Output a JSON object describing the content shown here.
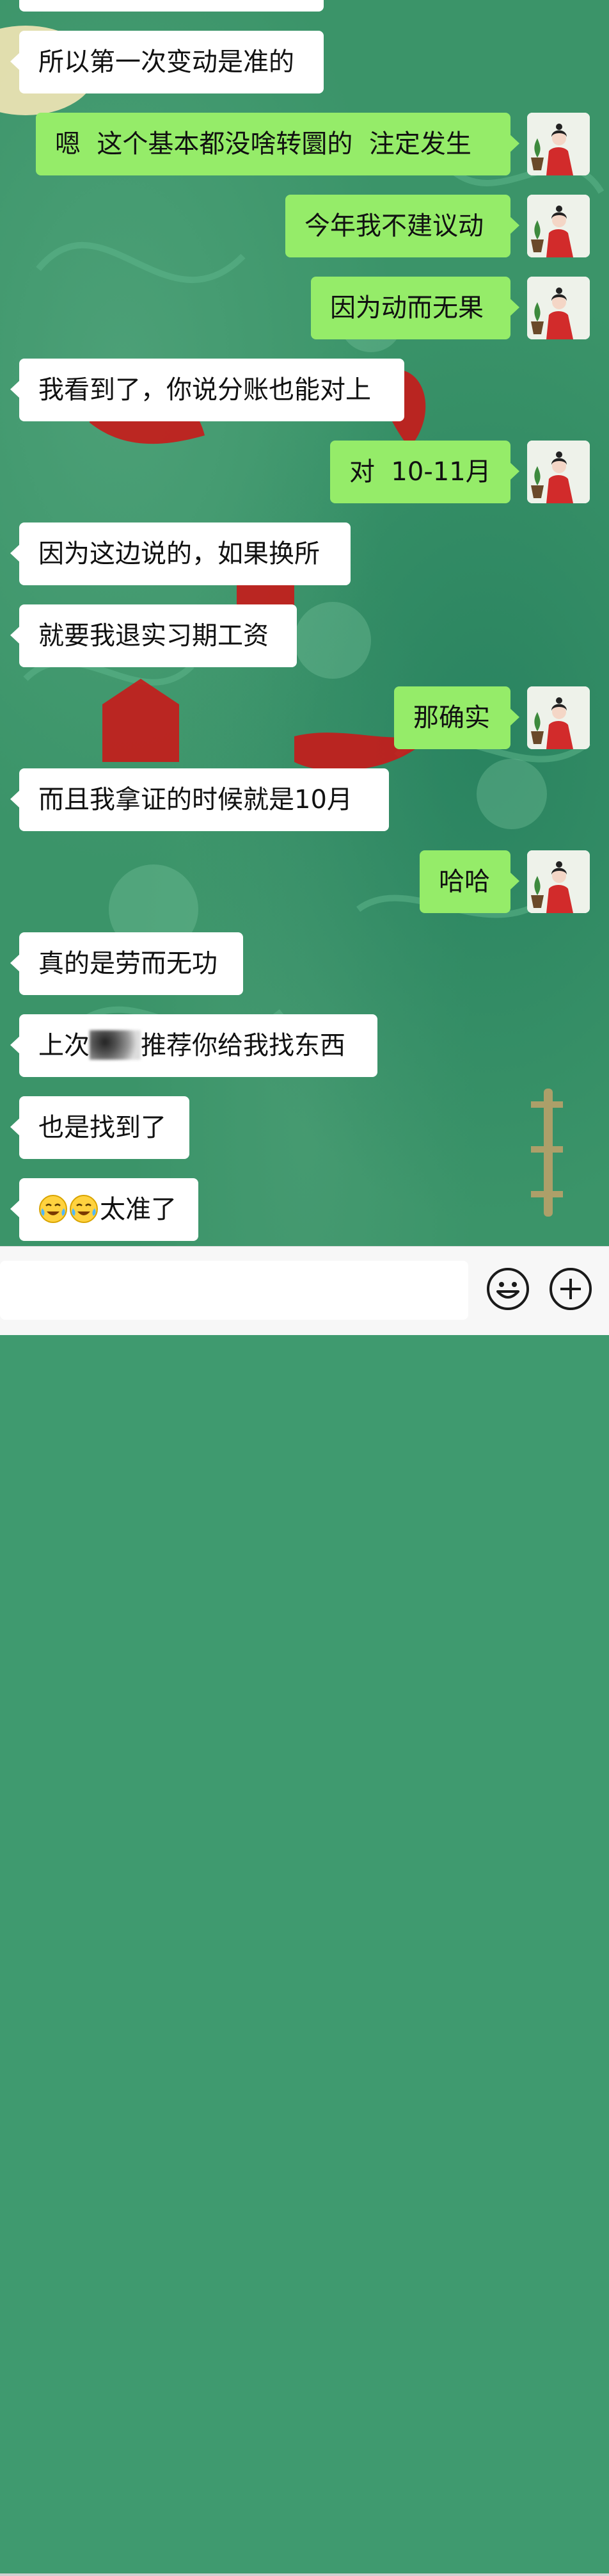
{
  "colors": {
    "chat_background": "#3b9469",
    "incoming_bubble": "#ffffff",
    "outgoing_bubble": "#95ec69",
    "input_bar": "#f7f7f7"
  },
  "messages": [
    {
      "side": "in",
      "text": "所以第一次变动是准的"
    },
    {
      "side": "out",
      "text": "嗯  这个基本都没啥转圜的  注定发生"
    },
    {
      "side": "out",
      "text": "今年我不建议动"
    },
    {
      "side": "out",
      "text": "因为动而无果"
    },
    {
      "side": "in",
      "text": "我看到了，你说分账也能对上"
    },
    {
      "side": "out",
      "text": "对  10-11月"
    },
    {
      "side": "in",
      "text": "因为这边说的，如果换所"
    },
    {
      "side": "in",
      "text": "就要我退实习期工资"
    },
    {
      "side": "out",
      "text": "那确实"
    },
    {
      "side": "in",
      "text": "而且我拿证的时候就是10月"
    },
    {
      "side": "out",
      "text": "哈哈"
    },
    {
      "side": "in",
      "text": "真的是劳而无功"
    },
    {
      "side": "in",
      "text_before": "上次",
      "redacted": true,
      "text_after": "推荐你给我找东西"
    },
    {
      "side": "in",
      "text": "也是找到了"
    },
    {
      "side": "in",
      "emoji": [
        "crying-laughing-emoji",
        "crying-laughing-emoji"
      ],
      "text": "太准了"
    }
  ],
  "input_bar": {
    "message_input_value": "",
    "icons": [
      "smiley-icon",
      "plus-circle-icon"
    ]
  }
}
